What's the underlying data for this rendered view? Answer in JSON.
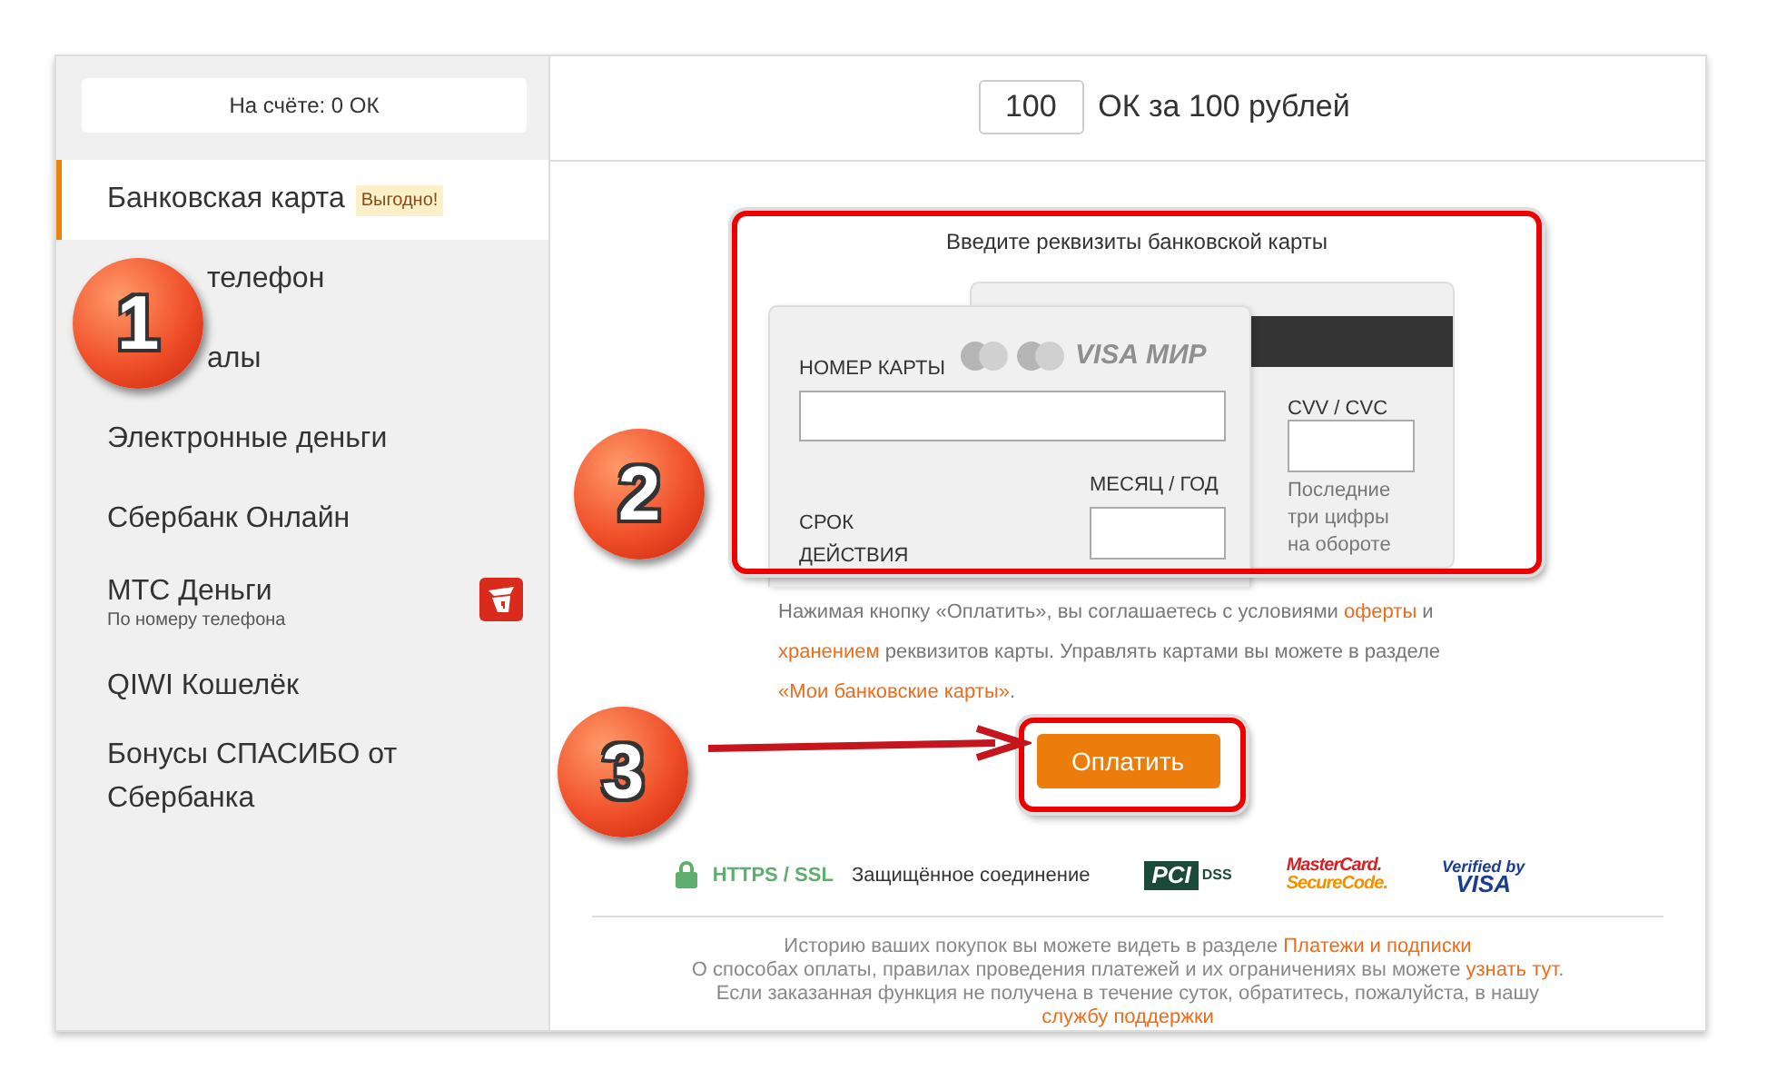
{
  "balance": "На счёте: 0 ОК",
  "menu": [
    {
      "label": "Банковская карта",
      "badge": "Выгодно!",
      "selected": true,
      "kind": "plain"
    },
    {
      "label": "телефон",
      "selected": false,
      "kind": "covered"
    },
    {
      "label": "алы",
      "selected": false,
      "kind": "covered"
    },
    {
      "label": "Электронные деньги",
      "selected": false,
      "kind": "plain"
    },
    {
      "label": "Сбербанк Онлайн",
      "selected": false,
      "kind": "plain"
    },
    {
      "label": "МТС Деньги",
      "sublabel": "По номеру телефона",
      "selected": false,
      "kind": "app"
    },
    {
      "label": "QIWI Кошелёк",
      "selected": false,
      "kind": "plain"
    },
    {
      "label": "Бонусы СПАСИБО от Сбербанка",
      "selected": false,
      "kind": "plain"
    }
  ],
  "amount": {
    "value": "100",
    "text": "ОК за 100 рублей"
  },
  "card_form": {
    "title": "Введите реквизиты банковской карты",
    "brands": [
      "VISA",
      "МИР"
    ],
    "number_label": "НОМЕР КАРТЫ",
    "expiry_label": "СРОК ДЕЙСТВИЯ",
    "month_year_label": "МЕСЯЦ / ГОД",
    "cvv_label": "CVV / CVC",
    "cvv_hint": "Последние три цифры на обороте"
  },
  "agreement": [
    {
      "kind": "text",
      "text": "Нажимая кнопку «Оплатить», вы соглашаетесь с условиями "
    },
    {
      "kind": "link",
      "text": "оферты"
    },
    {
      "kind": "text",
      "text": " и "
    },
    {
      "kind": "link",
      "text": "хранением"
    },
    {
      "kind": "text",
      "text": " реквизитов карты. Управлять картами вы можете в разделе "
    },
    {
      "kind": "link",
      "text": "«Мои банковские карты»"
    },
    {
      "kind": "text",
      "text": "."
    }
  ],
  "pay_button": "Оплатить",
  "security": {
    "protocol": "HTTPS / SSL",
    "text": "Защищённое соединение"
  },
  "badges": [
    {
      "kind": "pci",
      "lines": [
        "PCI",
        "DSS"
      ]
    },
    {
      "kind": "mastercard",
      "lines": [
        "MasterCard.",
        "SecureCode."
      ]
    },
    {
      "kind": "visa",
      "lines": [
        "Verified by",
        "VISA"
      ]
    }
  ],
  "footer": [
    [
      {
        "kind": "text",
        "text": "Историю ваших покупок вы можете видеть в разделе "
      },
      {
        "kind": "link",
        "text": "Платежи и подписки"
      }
    ],
    [
      {
        "kind": "text",
        "text": "О способах оплаты, правилах проведения платежей и их ограничениях вы можете "
      },
      {
        "kind": "link",
        "text": "узнать тут"
      },
      {
        "kind": "text",
        "text": "."
      }
    ],
    [
      {
        "kind": "text",
        "text": "Если заказанная функция не получена в течение суток, обратитесь, пожалуйста, в нашу"
      }
    ],
    [
      {
        "kind": "link",
        "text": "службу поддержки"
      }
    ]
  ],
  "annotations": [
    {
      "label": "1"
    },
    {
      "label": "2"
    },
    {
      "label": "3"
    }
  ]
}
